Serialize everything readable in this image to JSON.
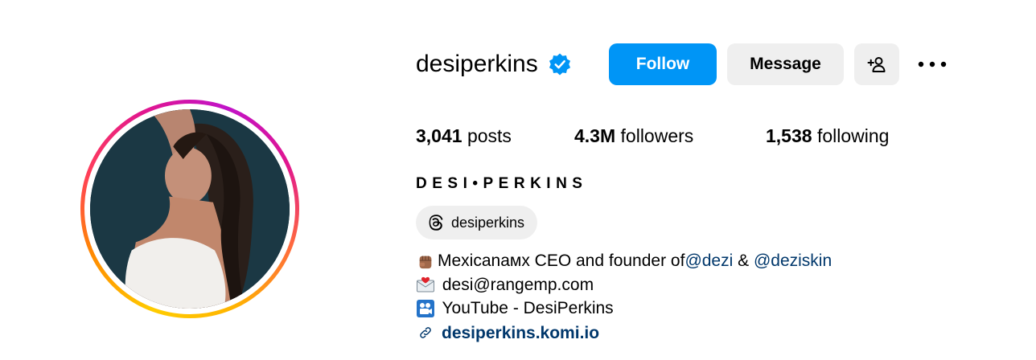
{
  "profile": {
    "username": "desiperkins",
    "verified": true,
    "follow_label": "Follow",
    "message_label": "Message",
    "stats": {
      "posts_count": "3,041",
      "posts_label": " posts",
      "followers_count": "4.3M",
      "followers_label": " followers",
      "following_count": "1,538",
      "following_label": " following"
    },
    "full_name": "DESI•PERKINS",
    "threads_handle": "desiperkins",
    "bio": {
      "line1_prefix": "Mexicanaмх CEO and founder of ",
      "line1_mention1": "@dezi",
      "line1_and": " & ",
      "line1_mention2": "@deziskin",
      "line2": " desi@rangemp.com",
      "line3": " YouTube - DesiPerkins",
      "link": "desiperkins.komi.io"
    }
  },
  "colors": {
    "follow_bg": "#0095f6",
    "secondary_btn_bg": "#efefef",
    "mention": "#00376b",
    "verified_badge": "#0095f6"
  },
  "icons": [
    "verified-badge-icon",
    "add-person-icon",
    "more-options-icon",
    "threads-icon",
    "raised-fist-emoji",
    "envelope-heart-emoji",
    "movie-camera-emoji",
    "link-icon"
  ]
}
